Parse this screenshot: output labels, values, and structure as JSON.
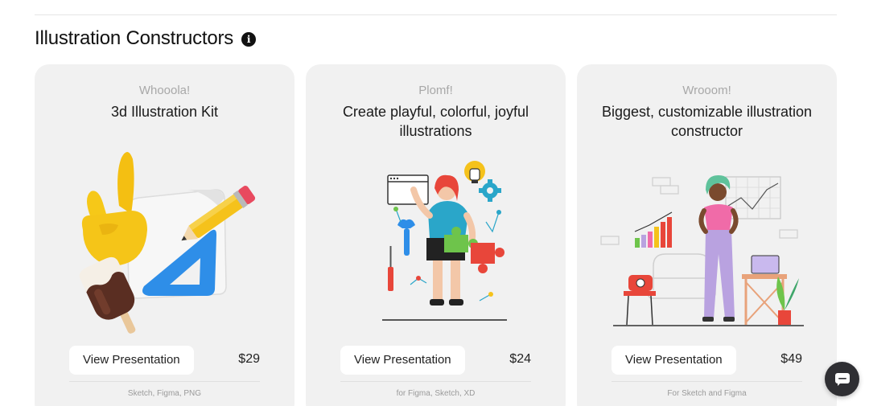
{
  "section": {
    "title": "Illustration Constructors",
    "info_icon": "info-icon"
  },
  "cards": [
    {
      "eyebrow": "Whooola!",
      "title": "3d Illustration Kit",
      "button_label": "View Presentation",
      "price": "$29",
      "formats": "Sketch, Figma, PNG",
      "illustration": "3d-hand-pencil-ruler-icecream"
    },
    {
      "eyebrow": "Plomf!",
      "title": "Create playful, colorful, joyful illustrations",
      "button_label": "View Presentation",
      "price": "$24",
      "formats": "for Figma, Sketch, XD",
      "illustration": "girl-with-puzzle-and-tools"
    },
    {
      "eyebrow": "Wrooom!",
      "title": "Biggest, customizable illustration constructor",
      "button_label": "View Presentation",
      "price": "$49",
      "formats": "For Sketch and Figma",
      "illustration": "woman-in-room-with-charts"
    }
  ],
  "chat": {
    "icon": "chat-icon"
  },
  "colors": {
    "card_bg": "#f1f1f1",
    "accent_blue": "#2e8ee8",
    "accent_yellow": "#f5c21b",
    "accent_red": "#e8463a",
    "accent_teal": "#2aa6c9",
    "accent_pink": "#f06ba8",
    "accent_purple": "#b9a2e0"
  }
}
